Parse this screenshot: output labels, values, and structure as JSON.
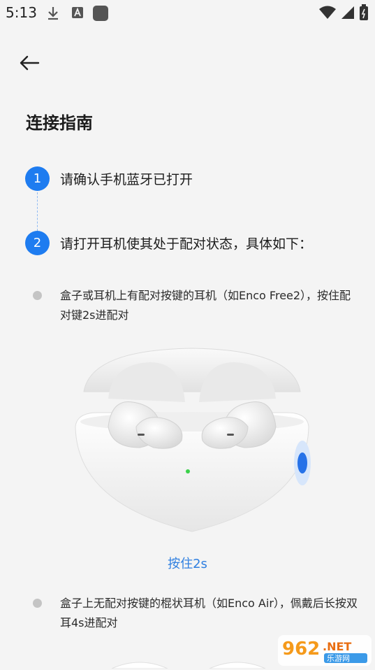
{
  "status_bar": {
    "time": "5:13",
    "icons": [
      "download-icon",
      "a-notification-icon",
      "app-square-icon",
      "wifi-icon",
      "signal-icon",
      "battery-icon"
    ]
  },
  "header": {
    "back_icon": "arrow-left-icon",
    "title": "连接指南"
  },
  "steps": [
    {
      "number": "1",
      "text": "请确认手机蓝牙已打开"
    },
    {
      "number": "2",
      "text": "请打开耳机使其处于配对状态，具体如下："
    }
  ],
  "methods": [
    {
      "text": "盒子或耳机上有配对按键的耳机（如Enco Free2），按住配对键2s进配对"
    },
    {
      "text": "盒子上无配对按键的棍状耳机（如Enco Air），佩戴后长按双耳4s进配对"
    }
  ],
  "image_caption": "按住2s",
  "watermark": {
    "number": "962",
    "suffix": ".NET",
    "subtitle": "乐游网"
  },
  "colors": {
    "accent": "#1e7cf0",
    "caption": "#2f7fe0",
    "background": "#f4f4f4"
  }
}
